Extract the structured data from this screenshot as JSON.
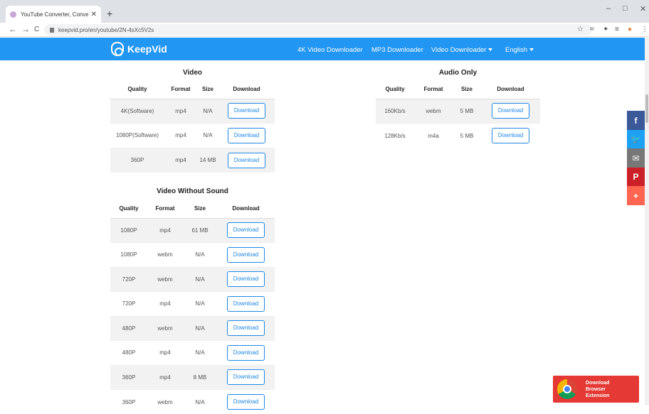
{
  "browser": {
    "tab_title": "YouTube Converter, Convert Vid",
    "tab_close": "✕",
    "new_tab": "+",
    "url": "keepvid.pro/en/youtube/2N-4sXc5V2s",
    "window_controls": [
      "–",
      "□",
      "✕"
    ],
    "nav": {
      "back": "←",
      "forward": "→",
      "reload": "C"
    }
  },
  "header": {
    "brand": "KeepVid",
    "menu": [
      {
        "label": "4K Video Downloader",
        "dropdown": false
      },
      {
        "label": "MP3 Downloader",
        "dropdown": false
      },
      {
        "label": "Video Downloader",
        "dropdown": true
      },
      {
        "label": "English",
        "dropdown": true
      }
    ],
    "accent_color": "#2196f3"
  },
  "video": {
    "title": "Video",
    "columns": [
      "Quality",
      "Format",
      "Size",
      "Download"
    ],
    "rows": [
      {
        "quality": "4K(Software)",
        "format": "mp4",
        "size": "N/A",
        "download": "Download"
      },
      {
        "quality": "1080P(Software)",
        "format": "mp4",
        "size": "N/A",
        "download": "Download"
      },
      {
        "quality": "360P",
        "format": "mp4",
        "size": "14 MB",
        "download": "Download"
      }
    ]
  },
  "audio": {
    "title": "Audio Only",
    "columns": [
      "Quality",
      "Format",
      "Size",
      "Download"
    ],
    "rows": [
      {
        "quality": "160Kb/s",
        "format": "webm",
        "size": "5 MB",
        "download": "Download"
      },
      {
        "quality": "128Kb/s",
        "format": "m4a",
        "size": "5 MB",
        "download": "Download"
      }
    ]
  },
  "video_no_sound": {
    "title": "Video Without Sound",
    "columns": [
      "Quality",
      "Format",
      "Size",
      "Download"
    ],
    "rows": [
      {
        "quality": "1080P",
        "format": "mp4",
        "size": "61 MB",
        "download": "Download"
      },
      {
        "quality": "1080P",
        "format": "webm",
        "size": "N/A",
        "download": "Download"
      },
      {
        "quality": "720P",
        "format": "webm",
        "size": "N/A",
        "download": "Download"
      },
      {
        "quality": "720P",
        "format": "mp4",
        "size": "N/A",
        "download": "Download"
      },
      {
        "quality": "480P",
        "format": "webm",
        "size": "N/A",
        "download": "Download"
      },
      {
        "quality": "480P",
        "format": "mp4",
        "size": "N/A",
        "download": "Download"
      },
      {
        "quality": "360P",
        "format": "mp4",
        "size": "8 MB",
        "download": "Download"
      },
      {
        "quality": "360P",
        "format": "webm",
        "size": "N/A",
        "download": "Download"
      }
    ]
  },
  "social": [
    {
      "icon": "facebook-icon",
      "glyph": "f",
      "color": "#3b5998"
    },
    {
      "icon": "twitter-icon",
      "glyph": "🐦",
      "color": "#1da1f2"
    },
    {
      "icon": "email-icon",
      "glyph": "✉",
      "color": "#777777"
    },
    {
      "icon": "pinterest-icon",
      "glyph": "P",
      "color": "#cb2027"
    },
    {
      "icon": "more-share-icon",
      "glyph": "+",
      "color": "#ff6550"
    }
  ],
  "extension_banner": {
    "lines": [
      "Download",
      "Browser",
      "Extension"
    ],
    "color": "#e53935"
  }
}
